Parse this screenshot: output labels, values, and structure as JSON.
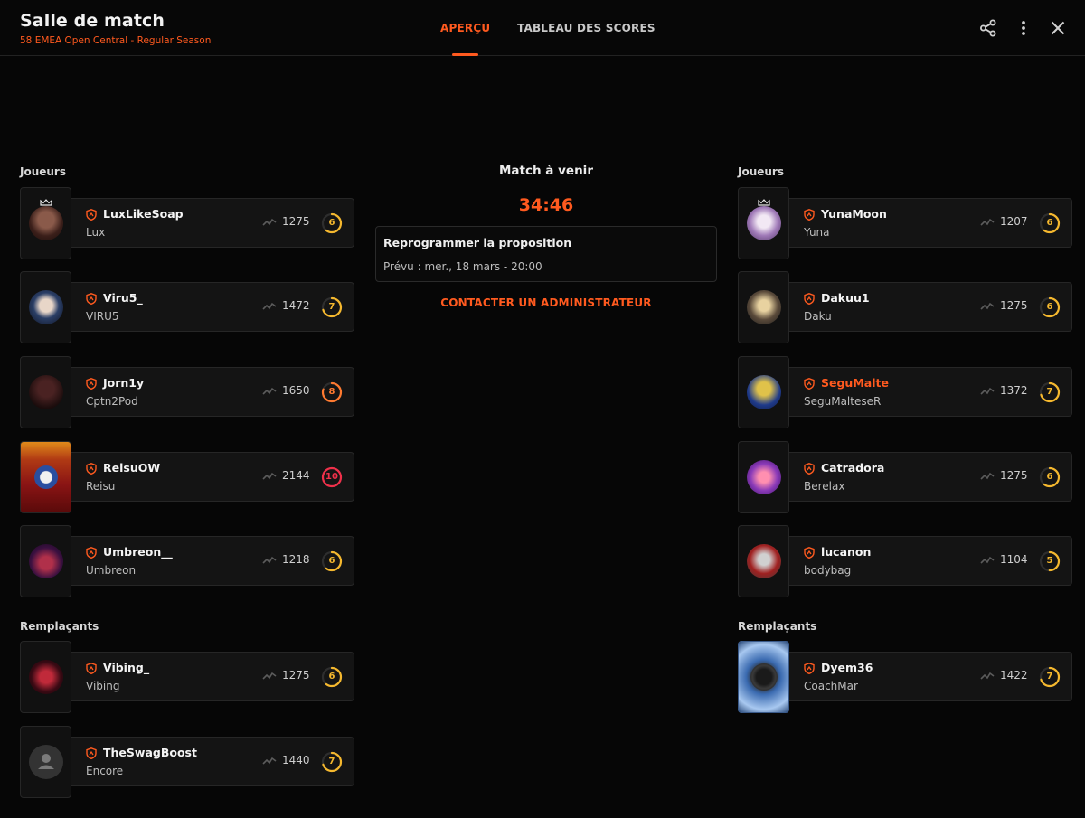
{
  "header": {
    "title": "Salle de match",
    "subtitle": "58 EMEA Open Central - Regular Season",
    "tabs": [
      "APERÇU",
      "TABLEAU DES SCORES"
    ],
    "active_tab": "APERÇU",
    "icons": [
      "share-icon",
      "more-vertical-icon",
      "close-icon"
    ]
  },
  "colors": {
    "accent": "#ff5a1f",
    "level_yellow": "#f5b82e",
    "level_orange": "#ff7a30",
    "level_red": "#f0304a"
  },
  "center": {
    "title": "Match à venir",
    "timer": "34:46",
    "proposal_title": "Reprogrammer la proposition",
    "proposal_date": "Prévu : mer., 18 mars - 20:00",
    "contact_label": "CONTACTER UN ADMINISTRATEUR"
  },
  "left": {
    "players_label": "Joueurs",
    "subs_label": "Remplaçants",
    "players": [
      {
        "name": "LuxLikeSoap",
        "display": "Lux",
        "rating": "1275",
        "level": "6",
        "captain": true
      },
      {
        "name": "Viru5_",
        "display": "VIRU5",
        "rating": "1472",
        "level": "7",
        "captain": false
      },
      {
        "name": "Jorn1y",
        "display": "Cptn2Pod",
        "rating": "1650",
        "level": "8",
        "captain": false
      },
      {
        "name": "ReisuOW",
        "display": "Reisu",
        "rating": "2144",
        "level": "10",
        "captain": false
      },
      {
        "name": "Umbreon__",
        "display": "Umbreon",
        "rating": "1218",
        "level": "6",
        "captain": false
      }
    ],
    "subs": [
      {
        "name": "Vibing_",
        "display": "Vibing",
        "rating": "1275",
        "level": "6",
        "captain": false
      },
      {
        "name": "TheSwagBoost",
        "display": "Encore",
        "rating": "1440",
        "level": "7",
        "captain": false
      }
    ]
  },
  "right": {
    "players_label": "Joueurs",
    "subs_label": "Remplaçants",
    "players": [
      {
        "name": "YunaMoon",
        "display": "Yuna",
        "rating": "1207",
        "level": "6",
        "captain": true
      },
      {
        "name": "Dakuu1",
        "display": "Daku",
        "rating": "1275",
        "level": "6",
        "captain": false
      },
      {
        "name": "SeguMalte",
        "display": "SeguMalteseR",
        "rating": "1372",
        "level": "7",
        "captain": false,
        "highlight": true
      },
      {
        "name": "Catradora",
        "display": "Berelax",
        "rating": "1275",
        "level": "6",
        "captain": false
      },
      {
        "name": "lucanon",
        "display": "bodybag",
        "rating": "1104",
        "level": "5",
        "captain": false
      }
    ],
    "subs": [
      {
        "name": "Dyem36",
        "display": "CoachMar",
        "rating": "1422",
        "level": "7",
        "captain": false
      }
    ]
  }
}
